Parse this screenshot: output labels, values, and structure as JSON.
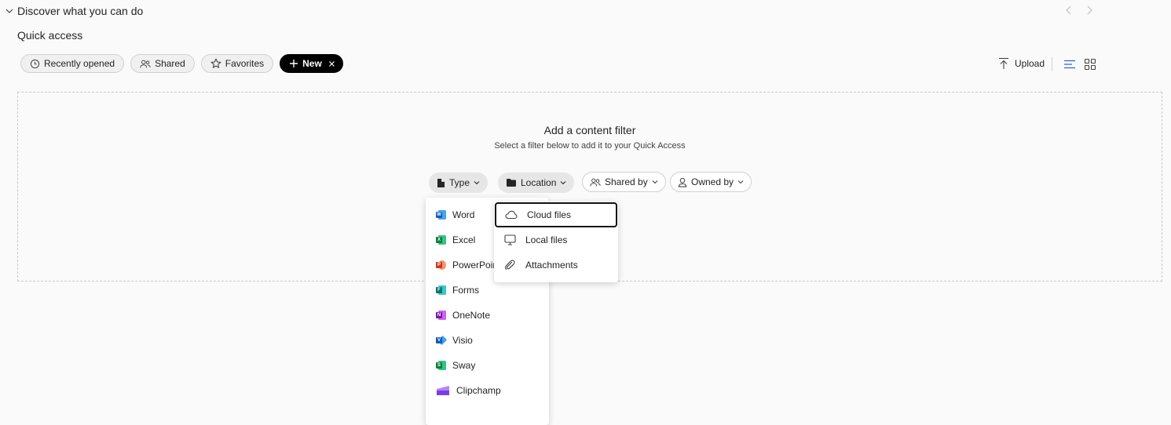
{
  "section": {
    "discover_label": "Discover what you can do",
    "quick_access_title": "Quick access"
  },
  "pills": [
    {
      "label": "Recently opened",
      "icon": "clock-icon"
    },
    {
      "label": "Shared",
      "icon": "people-icon"
    },
    {
      "label": "Favorites",
      "icon": "star-icon"
    },
    {
      "label": "New",
      "icon": "plus-icon",
      "selected": true
    }
  ],
  "toolbar": {
    "upload_label": "Upload"
  },
  "filter": {
    "title": "Add a content filter",
    "subtitle": "Select a filter below to add it to your Quick Access",
    "chips": [
      {
        "label": "Type",
        "icon": "document-icon",
        "expanded": true
      },
      {
        "label": "Location",
        "icon": "folder-icon",
        "expanded": true
      },
      {
        "label": "Shared by",
        "icon": "people-icon",
        "expanded": false
      },
      {
        "label": "Owned by",
        "icon": "person-icon",
        "expanded": false
      }
    ]
  },
  "type_menu": [
    {
      "label": "Word",
      "letter": "W",
      "color": "#185abd",
      "accent": "#41a5ee"
    },
    {
      "label": "Excel",
      "letter": "X",
      "color": "#107c41",
      "accent": "#33c481"
    },
    {
      "label": "PowerPoint",
      "letter": "P",
      "color": "#c43e1c",
      "accent": "#ff8f6b"
    },
    {
      "label": "Forms",
      "letter": "F",
      "color": "#077568",
      "accent": "#37c6d0"
    },
    {
      "label": "OneNote",
      "letter": "N",
      "color": "#7719aa",
      "accent": "#ca64ea"
    },
    {
      "label": "Visio",
      "letter": "V",
      "color": "#185abd",
      "accent": "#41a5ee"
    },
    {
      "label": "Sway",
      "letter": "S",
      "color": "#107c41",
      "accent": "#33c481"
    },
    {
      "label": "Clipchamp",
      "letter": "",
      "color": "#7a3fe4",
      "accent": "#b583ff"
    }
  ],
  "location_menu": [
    {
      "label": "Cloud files",
      "icon": "cloud-icon",
      "focused": true
    },
    {
      "label": "Local files",
      "icon": "monitor-icon",
      "focused": false
    },
    {
      "label": "Attachments",
      "icon": "paperclip-icon",
      "focused": false
    }
  ]
}
